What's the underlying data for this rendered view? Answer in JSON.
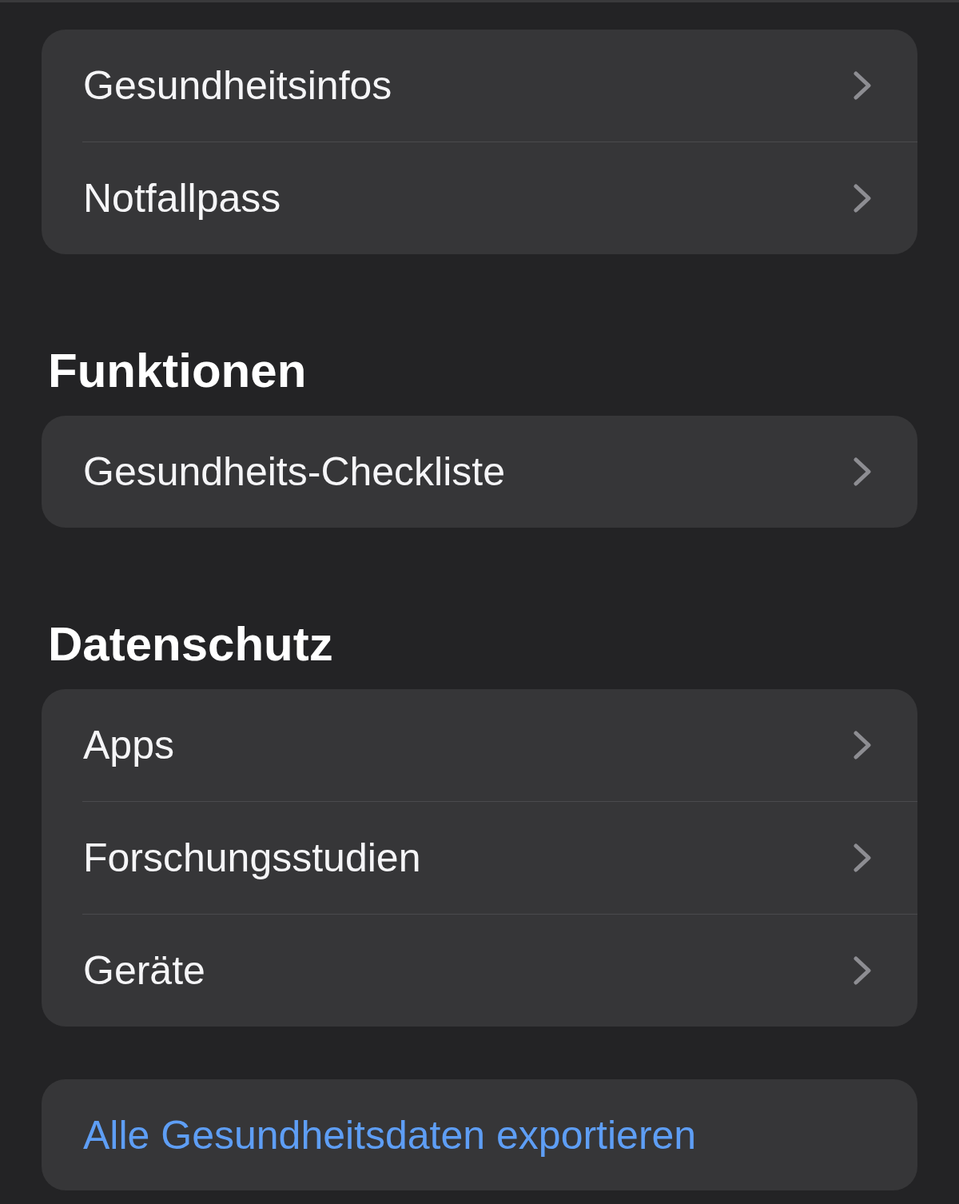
{
  "sections": [
    {
      "rows": [
        {
          "kind": "disclosure",
          "label": "Gesundheitsinfos"
        },
        {
          "kind": "disclosure",
          "label": "Notfallpass"
        }
      ]
    },
    {
      "title": "Funktionen",
      "rows": [
        {
          "kind": "disclosure",
          "label": "Gesundheits-Checkliste"
        }
      ]
    },
    {
      "title": "Datenschutz",
      "rows": [
        {
          "kind": "disclosure",
          "label": "Apps"
        },
        {
          "kind": "disclosure",
          "label": "Forschungsstudien"
        },
        {
          "kind": "disclosure",
          "label": "Geräte"
        }
      ]
    },
    {
      "rows": [
        {
          "kind": "action",
          "label": "Alle Gesundheitsdaten exportieren"
        }
      ]
    }
  ]
}
